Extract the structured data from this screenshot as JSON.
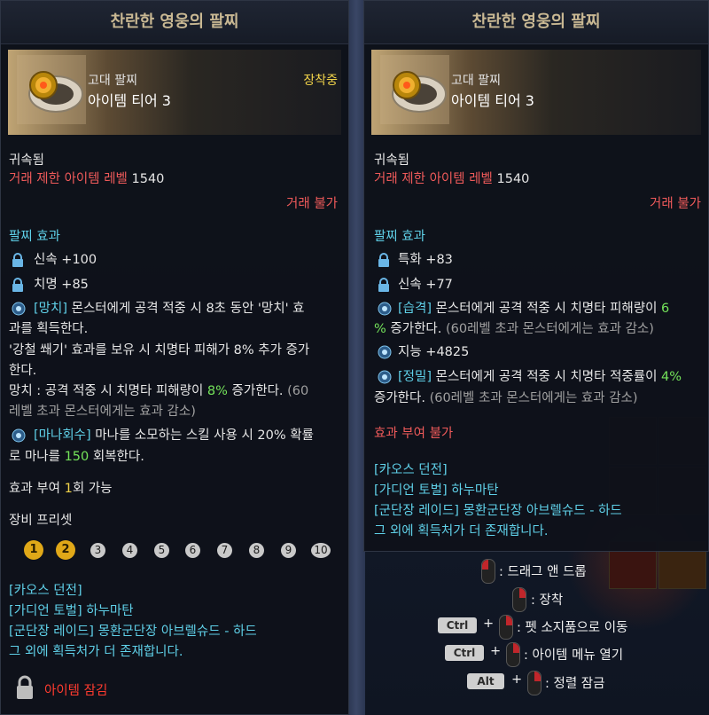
{
  "left": {
    "title": "찬란한 영웅의 팔찌",
    "kind": "고대 팔찌",
    "tier": "아이템 티어 3",
    "equipped": "장착중",
    "bound": "귀속됨",
    "trade_level_label": "거래 제한 아이템 레벨",
    "trade_level": "1540",
    "no_trade": "거래 불가",
    "effects_header": "팔찌 효과",
    "stats": [
      "신속 +100",
      "치명 +85"
    ],
    "skill1_name": "[망치]",
    "skill1_l1": "몬스터에게 공격 적중 시 8초 동안 '망치' 효",
    "skill1_l2": "과를 획득한다.",
    "skill1_l3": "'강철 쐐기' 효과를 보유 시 치명타 피해가 8% 추가 증가",
    "skill1_l4": "한다.",
    "skill1_l5a": "망치 : 공격 적중 시 치명타 피해량이",
    "skill1_l5b": "8%",
    "skill1_l5c": "증가한다.",
    "skill1_l5d": "(60",
    "skill1_l6": "레벨 초과 몬스터에게는 효과 감소)",
    "skill2_name": "[마나회수]",
    "skill2_l1": "마나를 소모하는 스킬 사용 시 20% 확률",
    "skill2_l2a": "로 마나를",
    "skill2_l2b": "150",
    "skill2_l2c": "회복한다.",
    "enchant_a": "효과 부여",
    "enchant_b": "1",
    "enchant_c": "회 가능",
    "preset_label": "장비 프리셋",
    "presets": [
      "1",
      "2",
      "3",
      "4",
      "5",
      "6",
      "7",
      "8",
      "9",
      "10"
    ],
    "sources": [
      "[카오스 던전]",
      "[가디언 토벌] 하누마탄",
      "[군단장 레이드] 몽환군단장 아브렐슈드 - 하드",
      "그 외에 획득처가 더 존재합니다."
    ],
    "locked": "아이템 잠김"
  },
  "right": {
    "title": "찬란한 영웅의 팔찌",
    "kind": "고대 팔찌",
    "tier": "아이템 티어 3",
    "bound": "귀속됨",
    "trade_level_label": "거래 제한 아이템 레벨",
    "trade_level": "1540",
    "no_trade": "거래 불가",
    "effects_header": "팔찌 효과",
    "stats": [
      "특화 +83",
      "신속 +77"
    ],
    "skill1_name": "[습격]",
    "skill1_l1a": "몬스터에게 공격 적중 시 치명타 피해량이",
    "skill1_l1b": "6",
    "skill1_l2a": "%",
    "skill1_l2b": "증가한다.",
    "skill1_l2c": "(60레벨 초과 몬스터에게는 효과 감소)",
    "stat3": "지능 +4825",
    "skill2_name": "[정밀]",
    "skill2_l1a": "몬스터에게 공격 적중 시 치명타 적중률이",
    "skill2_l1b": "4%",
    "skill2_l2a": "증가한다.",
    "skill2_l2b": "(60레벨 초과 몬스터에게는 효과 감소)",
    "no_enchant": "효과 부여 불가",
    "sources": [
      "[카오스 던전]",
      "[가디언 토벌] 하누마탄",
      "[군단장 레이드] 몽환군단장 아브렐슈드 - 하드",
      "그 외에 획득처가 더 존재합니다."
    ]
  },
  "hints": {
    "drag": ": 드래그 앤 드롭",
    "equip": ": 장착",
    "ctrl": "Ctrl",
    "pet": ": 펫 소지품으로 이동",
    "ctrl2": "Ctrl",
    "menu": ": 아이템 메뉴 열기",
    "alt": "Alt",
    "sort_lock": ": 정렬 잠금",
    "plus": "+"
  }
}
